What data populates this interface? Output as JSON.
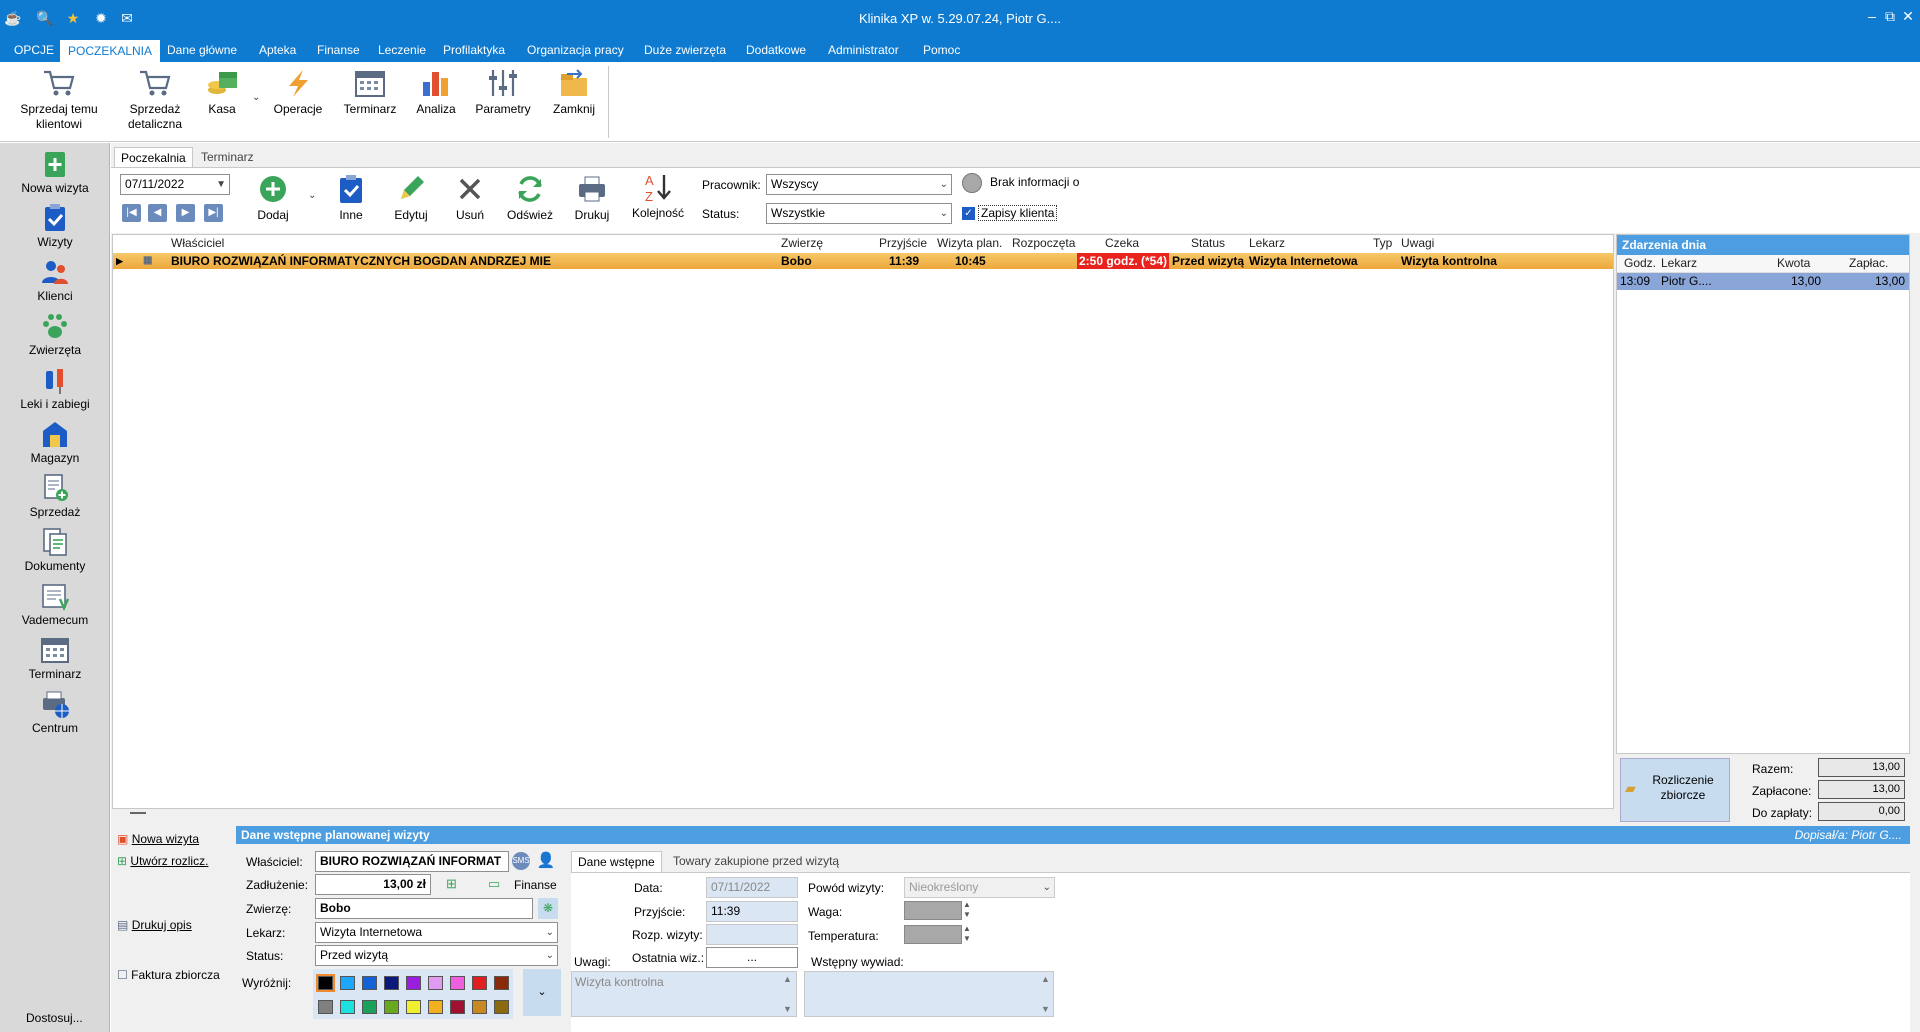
{
  "window": {
    "title": "Klinika XP w. 5.29.07.24, Piotr G....",
    "minimize": "–",
    "restore": "⧉",
    "close": "✕"
  },
  "menu": {
    "items": [
      "OPCJE",
      "POCZEKALNIA",
      "Dane główne",
      "Apteka",
      "Finanse",
      "Leczenie",
      "Profilaktyka",
      "Organizacja pracy",
      "Duże zwierzęta",
      "Dodatkowe",
      "Administrator",
      "Pomoc"
    ],
    "active": "POCZEKALNIA"
  },
  "ribbon": {
    "buttons": [
      {
        "label": "Sprzedaj temu klientowi",
        "icon": "cart-icon"
      },
      {
        "label": "Sprzedaż detaliczna",
        "icon": "cart-icon"
      },
      {
        "label": "Kasa",
        "icon": "cash-icon"
      },
      {
        "label": "Operacje",
        "icon": "bolt-icon"
      },
      {
        "label": "Terminarz",
        "icon": "calendar-icon"
      },
      {
        "label": "Analiza",
        "icon": "bar-chart-icon"
      },
      {
        "label": "Parametry",
        "icon": "sliders-icon"
      },
      {
        "label": "Zamknij",
        "icon": "folder-close-icon"
      }
    ]
  },
  "sidebar": {
    "items": [
      {
        "label": "Nowa wizyta",
        "icon": "plus-doc-icon"
      },
      {
        "label": "Wizyty",
        "icon": "clipboard-check-icon"
      },
      {
        "label": "Klienci",
        "icon": "users-icon"
      },
      {
        "label": "Zwierzęta",
        "icon": "paw-icon"
      },
      {
        "label": "Leki i zabiegi",
        "icon": "syringe-icon"
      },
      {
        "label": "Magazyn",
        "icon": "warehouse-icon"
      },
      {
        "label": "Sprzedaż",
        "icon": "sale-doc-icon"
      },
      {
        "label": "Dokumenty",
        "icon": "documents-icon"
      },
      {
        "label": "Vademecum",
        "icon": "book-icon"
      },
      {
        "label": "Terminarz",
        "icon": "calendar-icon"
      },
      {
        "label": "Centrum",
        "icon": "printer-globe-icon"
      }
    ],
    "customize": "Dostosuj..."
  },
  "tabs": [
    "Poczekalnia",
    "Terminarz"
  ],
  "toolbar": {
    "date": "07/11/2022",
    "buttons": [
      "Dodaj",
      "Inne",
      "Edytuj",
      "Usuń",
      "Odśwież",
      "Drukuj",
      "Kolejność"
    ],
    "employee_label": "Pracownik:",
    "employee_value": "Wszyscy",
    "status_label": "Status:",
    "status_value": "Wszystkie",
    "no_info": "Brak informacji o",
    "client_records": "Zapisy klienta"
  },
  "grid": {
    "headers": [
      "Właściciel",
      "Zwierzę",
      "Przyjście",
      "Wizyta plan.",
      "Rozpoczęta",
      "Czeka",
      "Status",
      "Lekarz",
      "Typ",
      "Uwagi"
    ],
    "rows": [
      {
        "owner": "BIURO ROZWIĄZAŃ INFORMATYCZNYCH BOGDAN ANDRZEJ MIE",
        "animal": "Bobo",
        "arrival": "11:39",
        "planned": "10:45",
        "started": "",
        "waiting": "2:50 godz. (*54)",
        "status": "Przed wizytą",
        "doctor": "Wizyta  Internetowa",
        "type": "",
        "notes": "Wizyta kontrolna"
      }
    ]
  },
  "events": {
    "title": "Zdarzenia dnia",
    "headers": [
      "Godz.",
      "Lekarz",
      "Kwota",
      "Zapłac."
    ],
    "rows": [
      {
        "time": "13:09",
        "doctor": "Piotr G....",
        "amount": "13,00",
        "paid": "13,00"
      }
    ]
  },
  "summary": {
    "button": "Rozliczenie zbiorcze",
    "total_label": "Razem:",
    "total": "13,00",
    "paid_label": "Zapłacone:",
    "paid": "13,00",
    "due_label": "Do zapłaty:",
    "due": "0,00"
  },
  "bottom": {
    "title": "Dane wstępne planowanej wizyty",
    "added_by": "Dopisał/a: Piotr G....",
    "actions": [
      "Nowa wizyta",
      "Utwórz rozlicz.",
      "Drukuj opis",
      "Faktura zbiorcza"
    ],
    "owner_label": "Właściciel:",
    "owner": "BIURO ROZWIĄZAŃ INFORMAT",
    "debt_label": "Zadłużenie:",
    "debt": "13,00 zł",
    "finance": "Finanse",
    "animal_label": "Zwierzę:",
    "animal": "Bobo",
    "doctor_label": "Lekarz:",
    "doctor": "Wizyta  Internetowa",
    "status_label": "Status:",
    "status": "Przed wizytą",
    "highlight_label": "Wyróżnij:",
    "swatches_row1": [
      "#000000",
      "#1ea7ff",
      "#1463d6",
      "#0a1a7a",
      "#9b1ee0",
      "#e09af0",
      "#f05ee0",
      "#e02020",
      "#8b2a0a"
    ],
    "swatches_row2": [
      "#808080",
      "#1ee0e0",
      "#19a05a",
      "#6aa81e",
      "#f0f030",
      "#f0b020",
      "#a01030",
      "#c88a20",
      "#8b6a10"
    ],
    "subtabs": [
      "Dane wstępne",
      "Towary zakupione przed wizytą"
    ],
    "date_label": "Data:",
    "date": "07/11/2022",
    "arrival_label": "Przyjście:",
    "arrival": "11:39",
    "start_label": "Rozp. wizyty:",
    "start": "",
    "last_label": "Ostatnia wiz.:",
    "last": "...",
    "notes_label": "Uwagi:",
    "notes": "Wizyta kontrolna",
    "reason_label": "Powód wizyty:",
    "reason": "Nieokreślony",
    "weight_label": "Waga:",
    "temp_label": "Temperatura:",
    "interview_label": "Wstępny wywiad:"
  }
}
